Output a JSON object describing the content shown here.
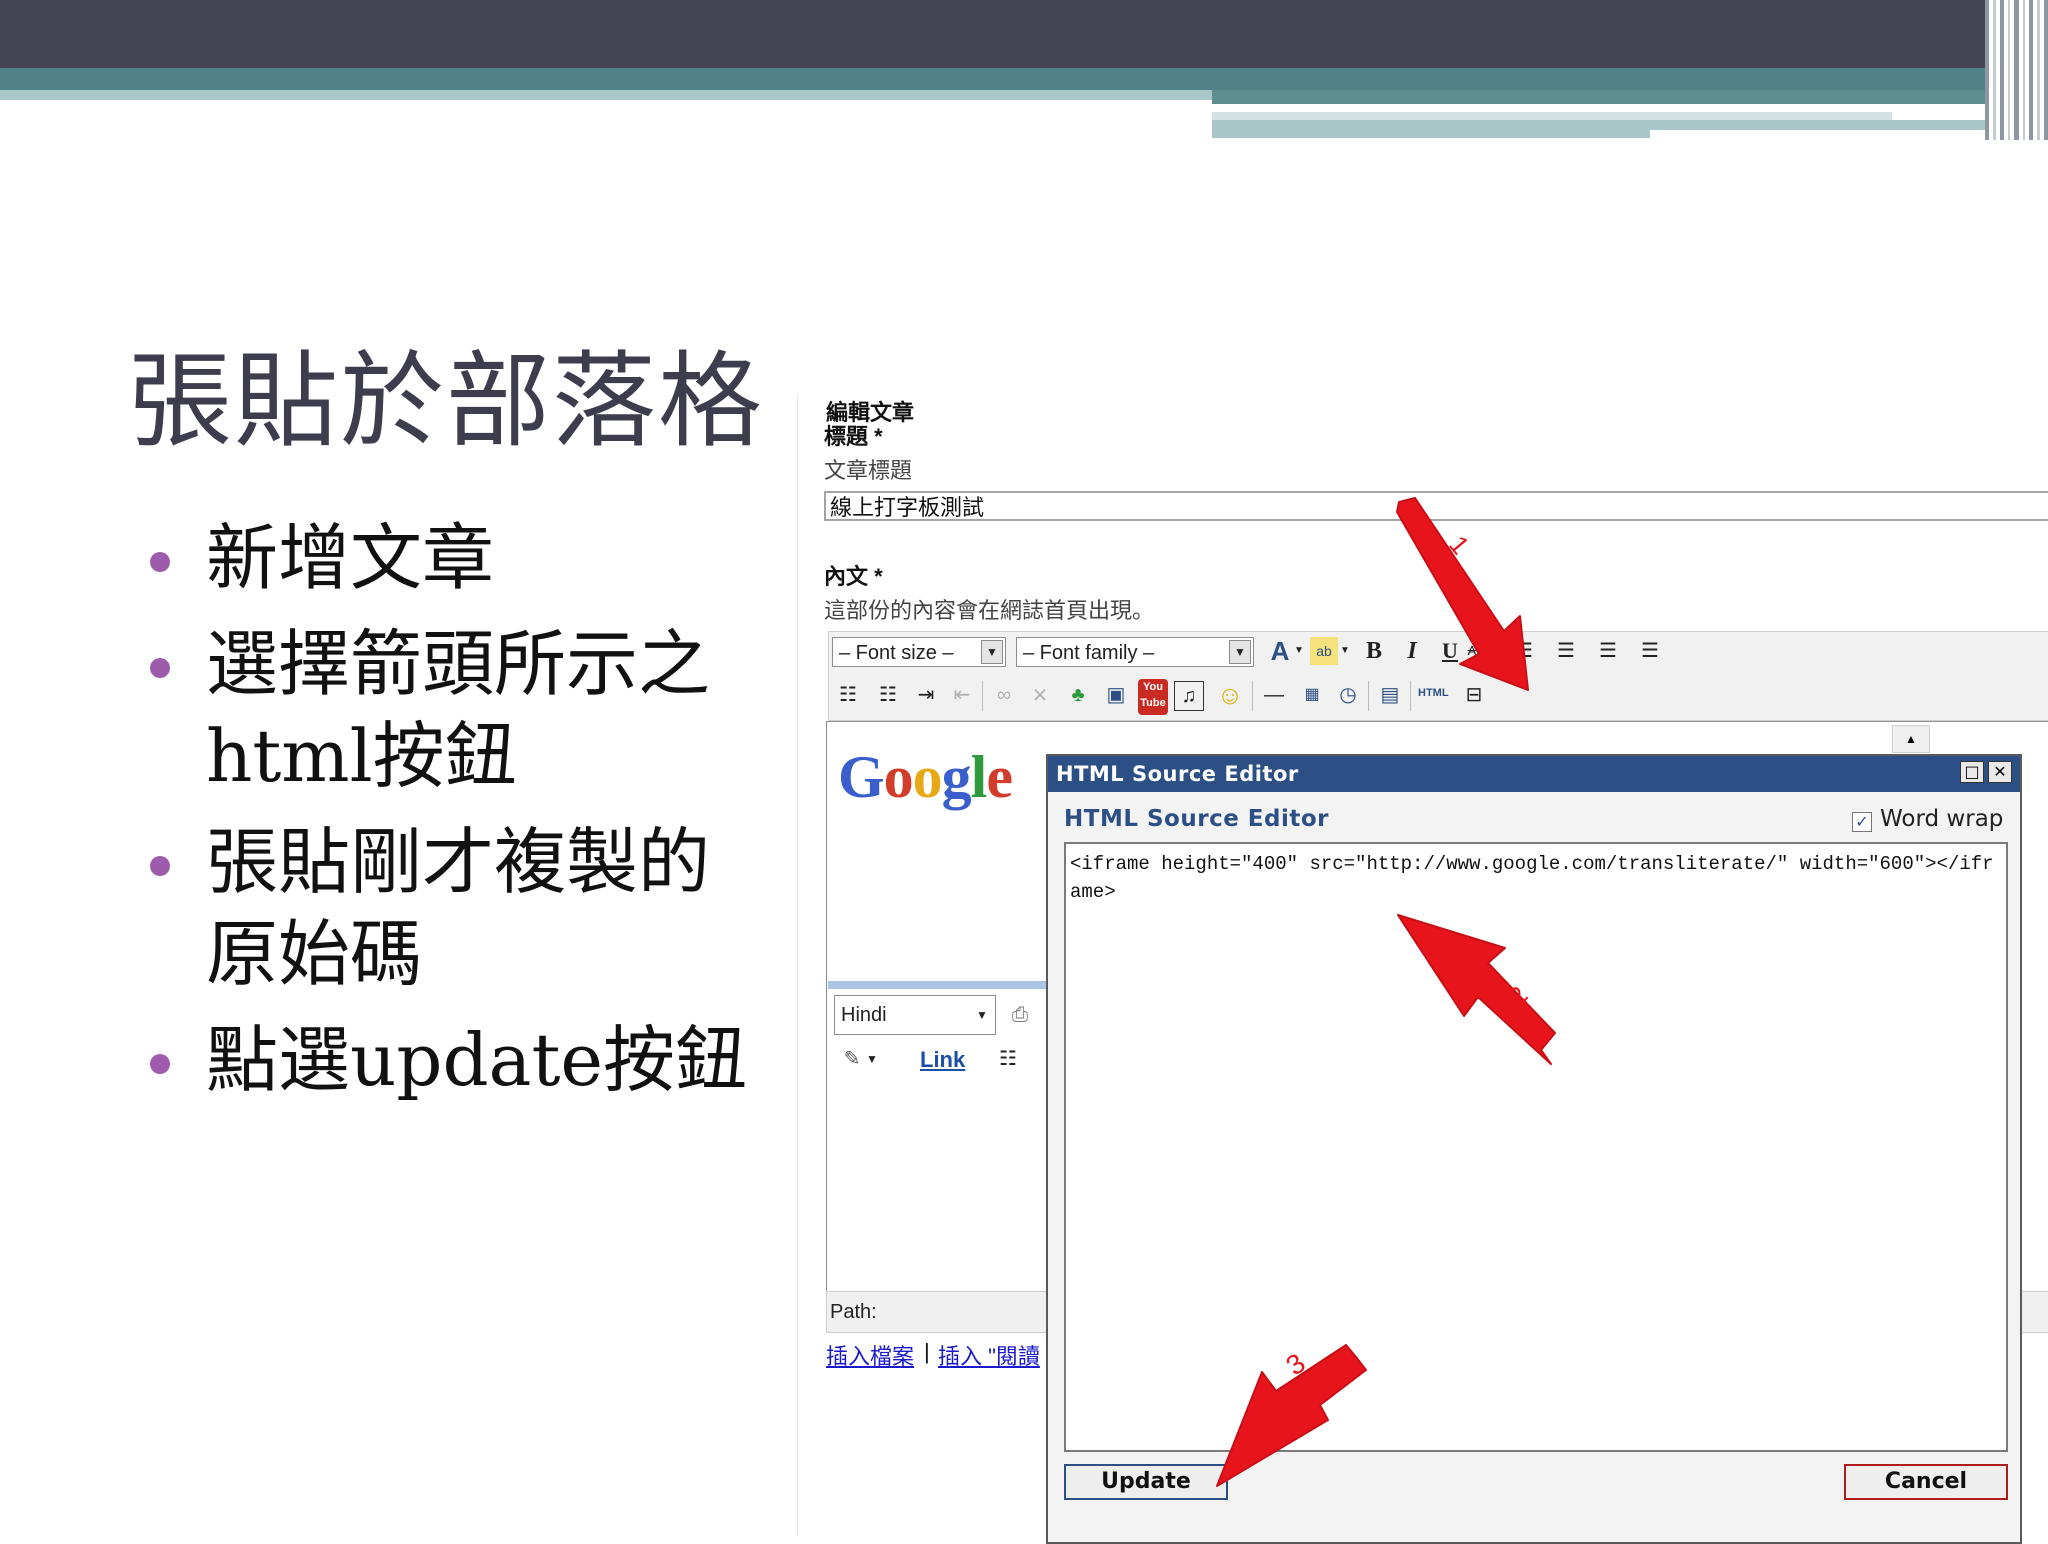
{
  "slide": {
    "title": "張貼於部落格",
    "bullets": [
      {
        "line1": "新增文章",
        "line2": ""
      },
      {
        "line1": "選擇箭頭所示之",
        "line2": "html按鈕"
      },
      {
        "line1": "張貼剛才複製的",
        "line2": "原始碼"
      },
      {
        "line1": "點選update按鈕",
        "line2": ""
      }
    ]
  },
  "editor": {
    "section_heading": "編輯文章",
    "title_label": "標題 *",
    "title_hint": "文章標題",
    "title_value": "線上打字板測試",
    "body_label": "內文 *",
    "body_hint": "這部份的內容會在網誌首頁出現。",
    "font_size_label": "– Font size –",
    "font_family_label": "– Font family –",
    "html_button_label": "HTML",
    "path_label": "Path:",
    "links": [
      "插入檔案",
      "插入 \"閱讀"
    ],
    "widget": {
      "logo": [
        "G",
        "o",
        "o",
        "g",
        "l",
        "e"
      ],
      "language": "Hindi",
      "link_label": "Link"
    }
  },
  "dialog": {
    "title": "HTML Source Editor",
    "heading": "HTML Source Editor",
    "word_wrap_label": "Word wrap",
    "word_wrap_checked": true,
    "code": "<iframe height=\"400\" src=\"http://www.google.com/transliterate/\" width=\"600\"></iframe>",
    "update_label": "Update",
    "cancel_label": "Cancel"
  },
  "annotations": {
    "arrow_labels": [
      "1",
      "2",
      "3"
    ],
    "color": "#e8141c"
  },
  "colors": {
    "header_dark": "#454556",
    "header_teal": "#4f8187",
    "bullet": "#9c5bab",
    "dialog_title": "#2c4f86",
    "google_blue": "#3a5fcd",
    "google_red": "#d23c2a",
    "google_yellow": "#e7a916",
    "google_green": "#2f9a3d"
  }
}
